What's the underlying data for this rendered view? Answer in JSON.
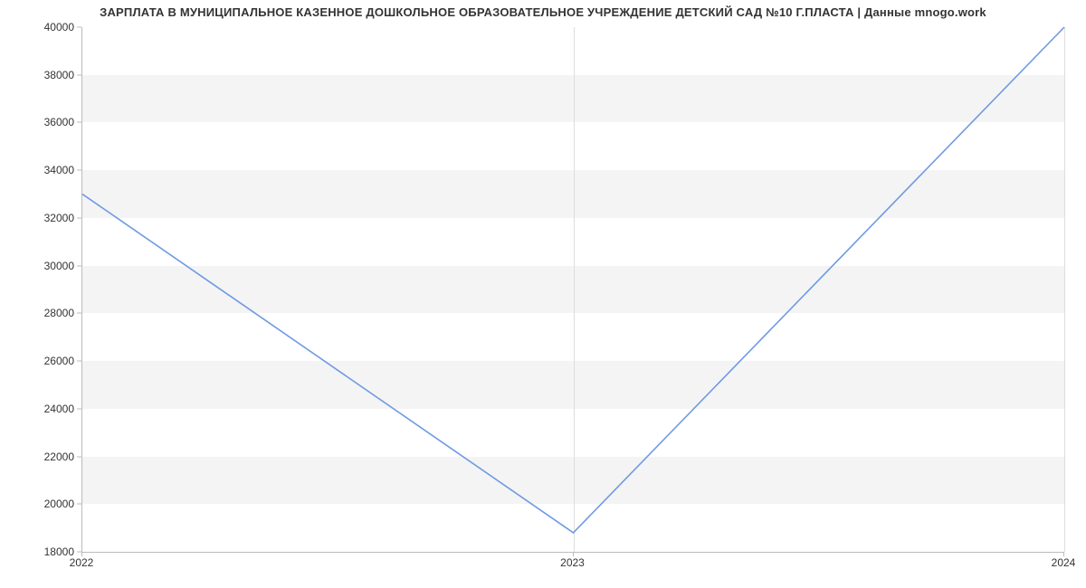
{
  "chart_data": {
    "type": "line",
    "title": "ЗАРПЛАТА В МУНИЦИПАЛЬНОЕ КАЗЕННОЕ ДОШКОЛЬНОЕ ОБРАЗОВАТЕЛЬНОЕ УЧРЕЖДЕНИЕ ДЕТСКИЙ САД №10 Г.ПЛАСТА | Данные mnogo.work",
    "x": [
      2022,
      2023,
      2024
    ],
    "values": [
      33000,
      18800,
      40000
    ],
    "xlabel": "",
    "ylabel": "",
    "xlim": [
      2022,
      2024
    ],
    "ylim": [
      18000,
      40000
    ],
    "y_ticks": [
      18000,
      20000,
      22000,
      24000,
      26000,
      28000,
      30000,
      32000,
      34000,
      36000,
      38000,
      40000
    ],
    "x_ticks": [
      2022,
      2023,
      2024
    ],
    "line_color": "#6f9ae3"
  }
}
